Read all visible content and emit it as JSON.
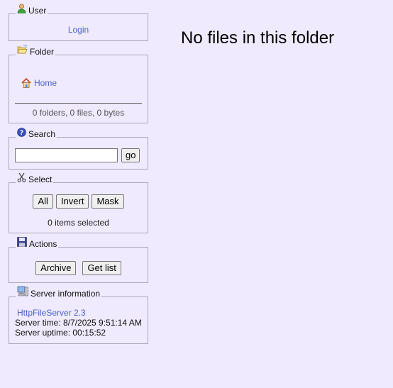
{
  "user": {
    "legend": "User",
    "login_label": "Login"
  },
  "folder": {
    "legend": "Folder",
    "home_label": "Home",
    "summary": "0 folders, 0 files, 0 bytes"
  },
  "search": {
    "legend": "Search",
    "input_value": "",
    "go_label": "go"
  },
  "select": {
    "legend": "Select",
    "buttons": [
      "All",
      "Invert",
      "Mask"
    ],
    "status": "0 items selected"
  },
  "actions": {
    "legend": "Actions",
    "archive_label": "Archive",
    "getlist_label": "Get list"
  },
  "server": {
    "legend": "Server information",
    "software": "HttpFileServer 2.3",
    "time": "Server time: 8/7/2025 9:51:14 AM",
    "uptime": "Server uptime: 00:15:52"
  },
  "main": {
    "message": "No files in this folder"
  },
  "colors": {
    "background": "#efeafd",
    "link": "#4a63c9",
    "border": "#a9a9b8"
  }
}
